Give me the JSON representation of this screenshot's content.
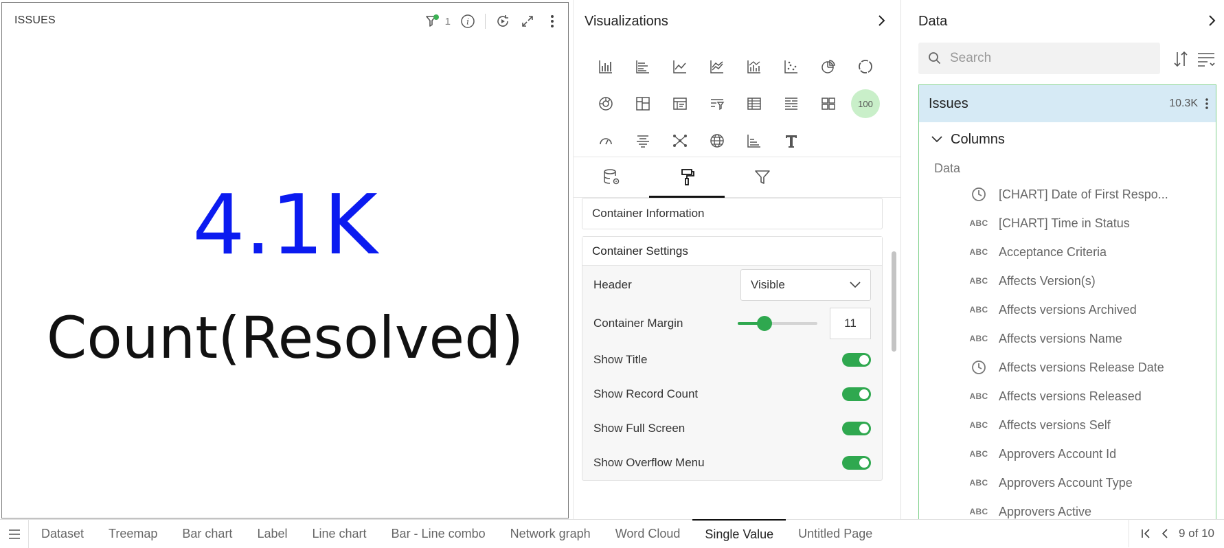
{
  "widget": {
    "title": "ISSUES",
    "filter_count": "1",
    "value": "4.1K",
    "label": "Count(Resolved)",
    "value_color": "#0b1bf0",
    "tools": [
      "filter-icon",
      "info-icon",
      "refresh-icon",
      "expand-icon",
      "more-icon"
    ]
  },
  "visualizations": {
    "title": "Visualizations",
    "active_badge": "100",
    "tiles": [
      "bar-chart-icon",
      "horizontal-bar-icon",
      "line-chart-icon",
      "area-line-icon",
      "bar-line-combo-icon",
      "scatter-icon",
      "pie-chart-icon",
      "donut-icon",
      "sunburst-icon",
      "treemap-icon",
      "pivot-icon",
      "list-filter-icon",
      "table-icon",
      "crosstab-icon",
      "grid-icon",
      "single-value-icon",
      "gauge-icon",
      "word-cloud-icon",
      "network-graph-icon",
      "map-icon",
      "histogram-icon",
      "text-icon"
    ],
    "tabs": [
      "data-tab",
      "format-tab",
      "filter-tab"
    ],
    "sections": {
      "info_title": "Container Information",
      "settings_title": "Container Settings",
      "header_label": "Header",
      "header_value": "Visible",
      "margin_label": "Container Margin",
      "margin_value": "11",
      "margin_fraction": 0.34,
      "toggles": [
        {
          "label": "Show Title",
          "on": true
        },
        {
          "label": "Show Record Count",
          "on": true
        },
        {
          "label": "Show Full Screen",
          "on": true
        },
        {
          "label": "Show Overflow Menu",
          "on": true
        }
      ]
    }
  },
  "data_panel": {
    "title": "Data",
    "search_placeholder": "Search",
    "dataset_name": "Issues",
    "dataset_count": "10.3K",
    "columns_label": "Columns",
    "group_label": "Data",
    "fields": [
      {
        "type": "clock",
        "name": "[CHART] Date of First Respo..."
      },
      {
        "type": "ABC",
        "name": "[CHART] Time in Status"
      },
      {
        "type": "ABC",
        "name": "Acceptance Criteria"
      },
      {
        "type": "ABC",
        "name": "Affects Version(s)"
      },
      {
        "type": "ABC",
        "name": "Affects versions Archived"
      },
      {
        "type": "ABC",
        "name": "Affects versions Name"
      },
      {
        "type": "clock",
        "name": "Affects versions Release Date"
      },
      {
        "type": "ABC",
        "name": "Affects versions Released"
      },
      {
        "type": "ABC",
        "name": "Affects versions Self"
      },
      {
        "type": "ABC",
        "name": "Approvers Account Id"
      },
      {
        "type": "ABC",
        "name": "Approvers Account Type"
      },
      {
        "type": "ABC",
        "name": "Approvers Active"
      }
    ]
  },
  "page_tabs": {
    "tabs": [
      "Dataset",
      "Treemap",
      "Bar chart",
      "Label",
      "Line chart",
      "Bar - Line combo",
      "Network graph",
      "Word Cloud",
      "Single Value",
      "Untitled Page"
    ],
    "active": 8,
    "pager": "9 of 10"
  }
}
